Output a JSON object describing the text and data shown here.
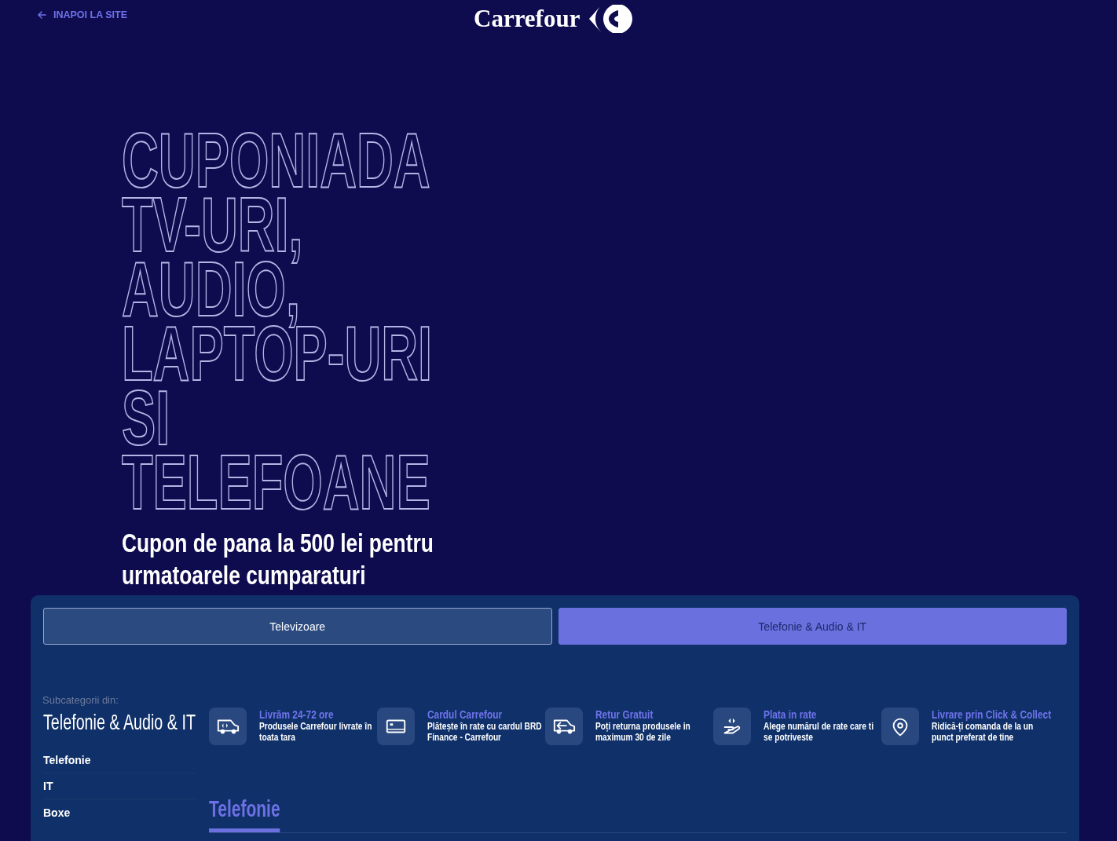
{
  "top_bar": {
    "back_link": "INAPOI LA SITE",
    "logo_text": "Carrefour"
  },
  "hero": {
    "title": "CUPONIADA TV-URI, AUDIO, LAPTOP-URI SI TELEFOANE",
    "subtitle": "Cupon de pana la 500 lei pentru urmatoarele cumparaturi"
  },
  "category_tabs": [
    {
      "label": "Televizoare",
      "selected": false
    },
    {
      "label": "Telefonie & Audio & IT",
      "selected": true
    }
  ],
  "sidebar": {
    "caption": "Subcategorii din:",
    "title": "Telefonie & Audio & IT",
    "items": [
      "Telefonie",
      "IT",
      "Boxe"
    ]
  },
  "benefits": [
    {
      "kind": "delivery",
      "title": "Livrăm 24-72 ore",
      "text": "Produsele Carrefour livrate în toata tara"
    },
    {
      "kind": "card",
      "title": "Cardul Carrefour",
      "text": "Plătește în rate cu cardul BRD Finance - Carrefour"
    },
    {
      "kind": "return",
      "title": "Retur Gratuit",
      "text": "Poți returna produsele in maximum 30 de zile"
    },
    {
      "kind": "installments",
      "title": "Plata in rate",
      "text": "Alege numărul de rate care ti se potriveste"
    },
    {
      "kind": "pickup",
      "title": "Livrare prin Click & Collect",
      "text": "Ridică-ți comanda de la un punct preferat de tine"
    }
  ],
  "section": {
    "title": "Telefonie"
  }
}
